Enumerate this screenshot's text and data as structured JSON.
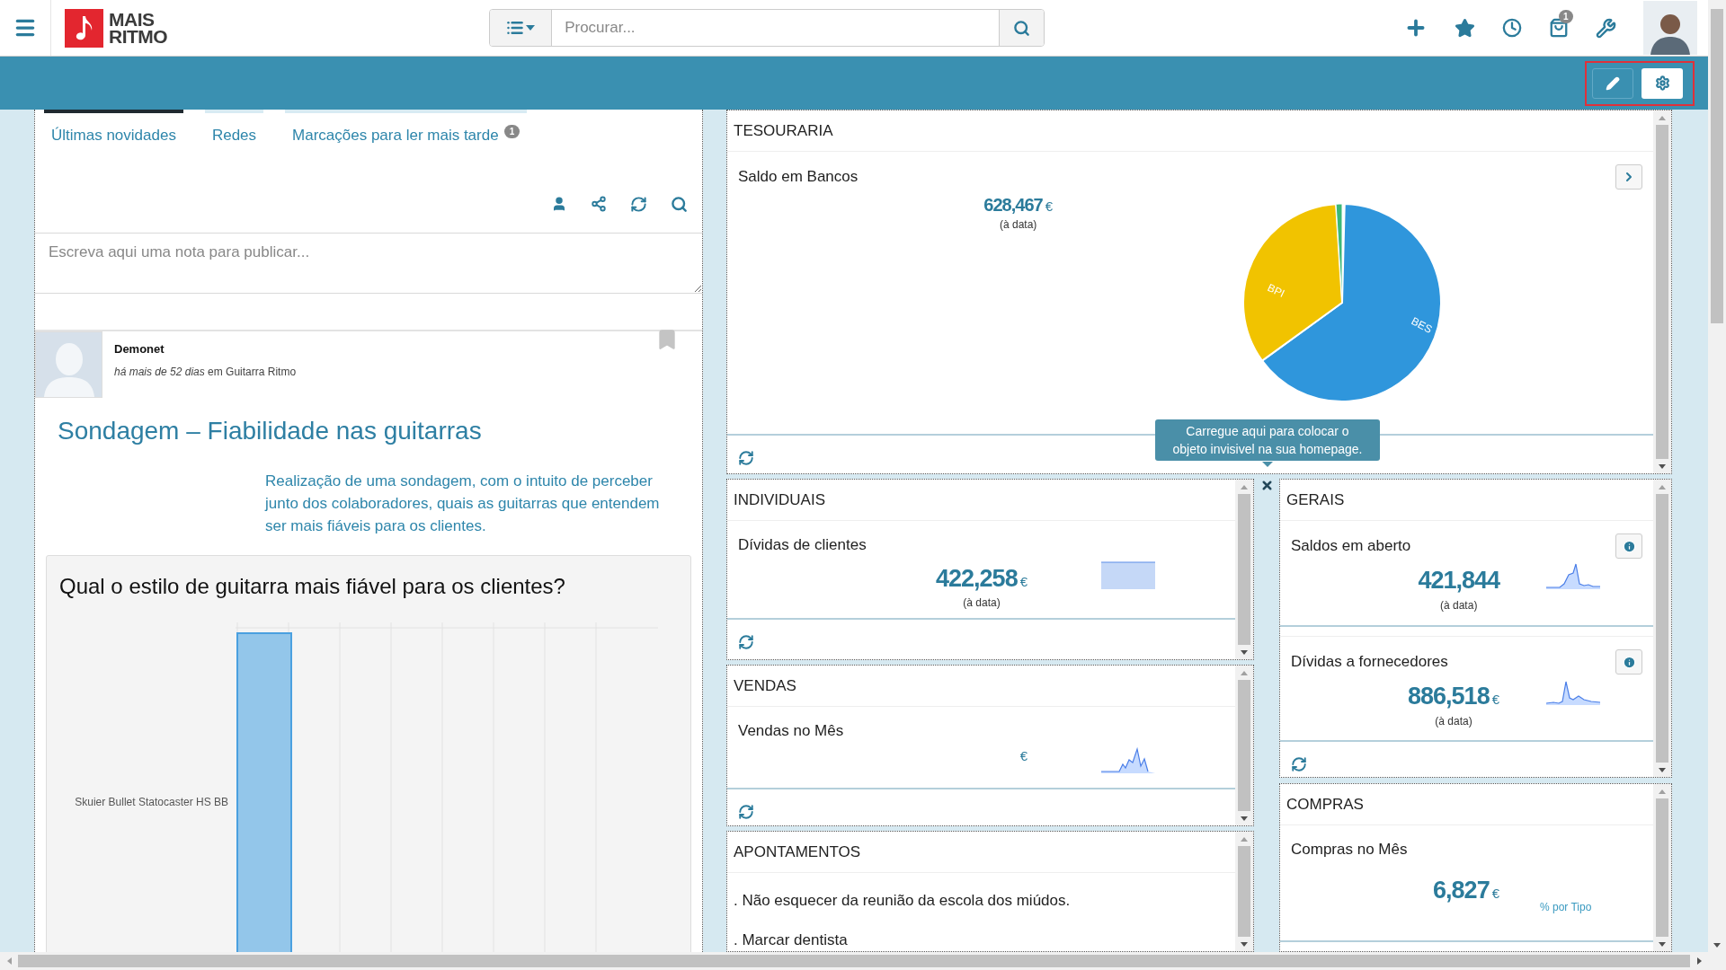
{
  "header": {
    "logo_text": [
      "MAIS",
      "RITMO"
    ],
    "search_placeholder": "Procurar...",
    "cart_badge": "1"
  },
  "feed": {
    "tabs": [
      {
        "label": "Últimas novidades",
        "selected": true
      },
      {
        "label": "Redes",
        "selected": false
      },
      {
        "label": "Marcações para ler mais tarde",
        "selected": false,
        "badge": "1"
      }
    ],
    "note_placeholder": "Escreva aqui uma nota para publicar...",
    "post": {
      "author": "Demonet",
      "meta": "*há mais de 52 dias* em Guitarra Ritmo",
      "title": "Sondagem – Fiabilidade nas guitarras",
      "description": "Realização de uma sondagem, com o intuito de perceber junto dos colaboradores, quais as guitarras que entendem ser mais fiáveis para os clientes.",
      "poll_question": "Qual o estilo de guitarra mais fiável para os clientes?",
      "poll_option": "Skuier Bullet Statocaster HS BB"
    }
  },
  "tooltip": "Carregue aqui para colocar o objeto invisivel na sua homepage.",
  "dashboard": {
    "top": [
      {
        "title": "TESOURARIA",
        "refresh": true,
        "items": [
          {
            "kind": "pie",
            "label": "Saldo em Bancos",
            "value": "628,467",
            "currency": "€",
            "caption": "(à data)",
            "slices": [
              {
                "label": "BES",
                "color": "#2f96dc"
              },
              {
                "label": "BPI",
                "color": "#f1c300"
              }
            ]
          }
        ]
      }
    ],
    "left": [
      {
        "title": "INDIVIDUAIS",
        "refresh": true,
        "items": [
          {
            "kind": "block",
            "label": "Dívidas de clientes",
            "value": "422,258",
            "currency": "€",
            "caption": "(à data)"
          }
        ]
      },
      {
        "title": "VENDAS",
        "refresh": true,
        "items": [
          {
            "kind": "spark",
            "label": "Vendas no Mês",
            "currency": "€"
          }
        ]
      },
      {
        "title": "APONTAMENTOS",
        "items": [
          {
            "kind": "note",
            "text": ". Não esquecer da reunião da escola dos miúdos."
          },
          {
            "kind": "note",
            "text": ". Marcar dentista"
          }
        ]
      }
    ],
    "right": [
      {
        "title": "GERAIS",
        "refresh": true,
        "items": [
          {
            "kind": "spark",
            "label": "Saldos em aberto",
            "value": "421,844",
            "caption": "(à data)",
            "info_button": true
          },
          {
            "kind": "spark",
            "label": "Dívidas a fornecedores",
            "value": "886,518",
            "currency": "€",
            "caption": "(à data)",
            "info_button": true
          }
        ]
      },
      {
        "title": "COMPRAS",
        "items": [
          {
            "kind": "plain",
            "label": "Compras no Mês",
            "value": "6,827",
            "currency": "€",
            "link": "% por Tipo"
          }
        ]
      }
    ]
  }
}
